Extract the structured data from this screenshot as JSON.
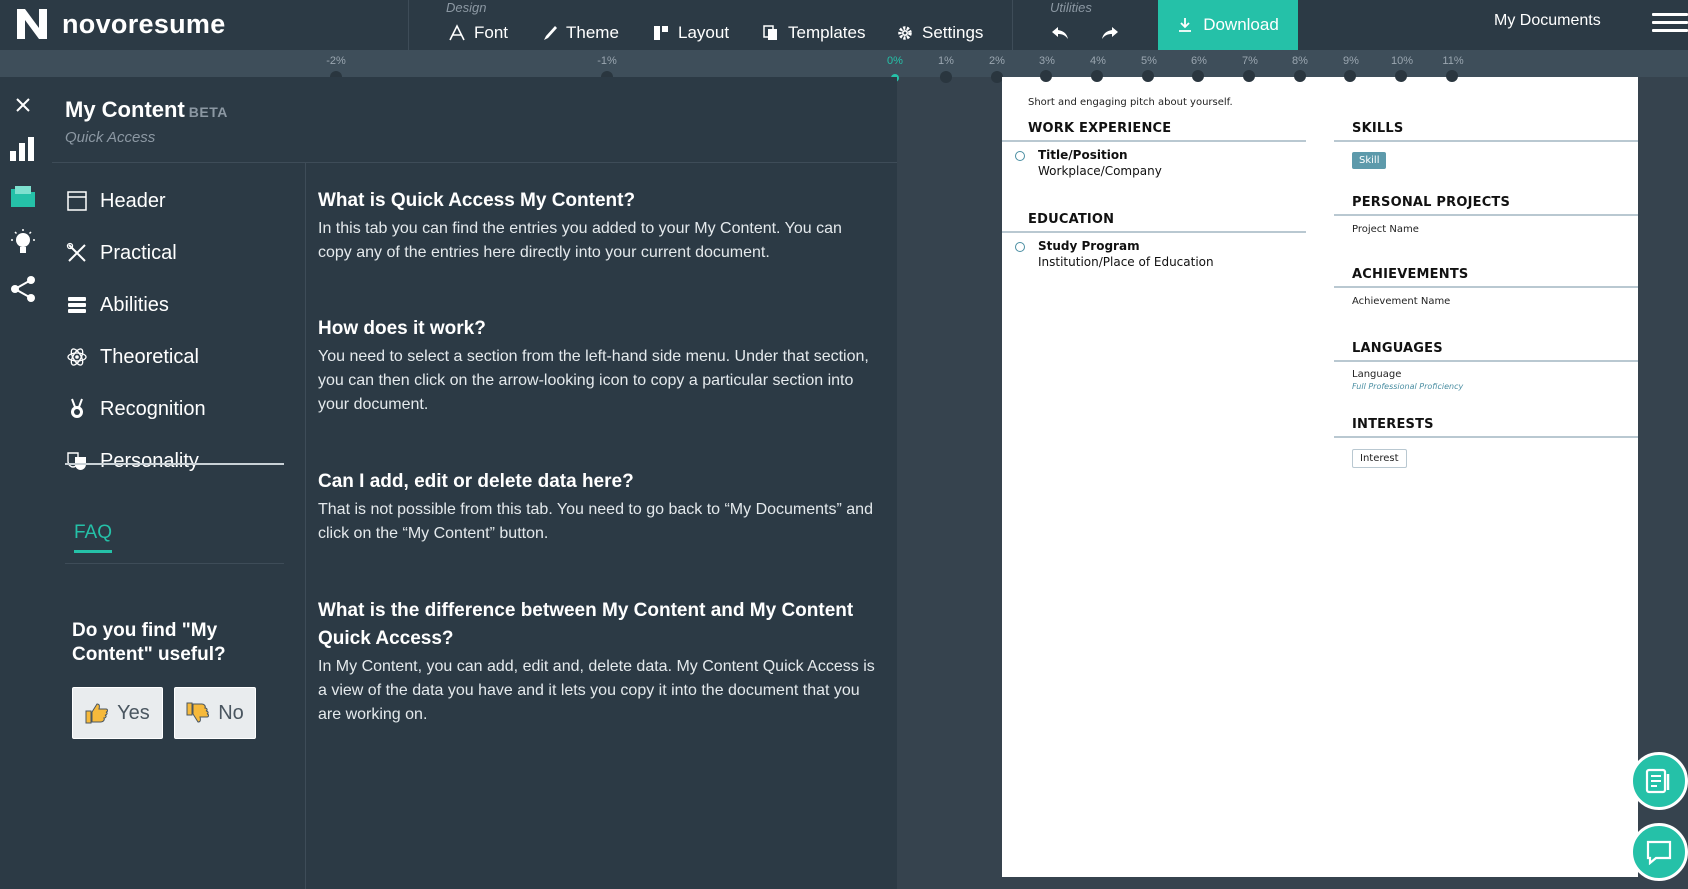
{
  "app": {
    "brand": "novoresume",
    "accent": "#25c1a8"
  },
  "toolbar": {
    "design_label": "Design",
    "font_label": "Font",
    "theme_label": "Theme",
    "layout_label": "Layout",
    "templates_label": "Templates",
    "settings_label": "Settings",
    "utilities_label": "Utilities",
    "download_label": "Download",
    "my_documents_label": "My Documents"
  },
  "ruler": {
    "ticks": [
      "-2%",
      "-1%",
      "0%",
      "1%",
      "2%",
      "3%",
      "4%",
      "5%",
      "6%",
      "7%",
      "8%",
      "9%",
      "10%",
      "11%"
    ],
    "active": "0%"
  },
  "panel": {
    "title": "My Content",
    "badge": "BETA",
    "subtitle": "Quick Access",
    "menu": [
      {
        "label": "Header",
        "icon": "header-icon"
      },
      {
        "label": "Practical",
        "icon": "tools-icon"
      },
      {
        "label": "Abilities",
        "icon": "stack-icon"
      },
      {
        "label": "Theoretical",
        "icon": "atom-icon"
      },
      {
        "label": "Recognition",
        "icon": "medal-icon"
      },
      {
        "label": "Personality",
        "icon": "masks-icon"
      }
    ],
    "faq_link": "FAQ",
    "useful_question": "Do you find \"My Content\" useful?",
    "yes_label": "Yes",
    "no_label": "No"
  },
  "faq": [
    {
      "q": "What is Quick Access My Content?",
      "a": "In this tab you can find the entries you added to your My Content. You can copy any of the entries here directly into your current document."
    },
    {
      "q": "How does it work?",
      "a": "You need to select a section from the left-hand side menu. Under that section, you can then click on the arrow-looking icon to copy a particular section into your document."
    },
    {
      "q": "Can I add, edit or delete data here?",
      "a": "That is not possible from this tab. You need to go back to “My Documents” and click on the “My Content” button."
    },
    {
      "q": "What is the difference between My Content and My Content Quick Access?",
      "a": "In My Content, you can add, edit and, delete data. My Content Quick Access is a view of the data you have and it lets you copy it into the document that you are working on."
    }
  ],
  "resume": {
    "pitch": "Short and engaging pitch about yourself.",
    "work_heading": "WORK EXPERIENCE",
    "work_title": "Title/Position",
    "work_company": "Workplace/Company",
    "education_heading": "EDUCATION",
    "edu_title": "Study Program",
    "edu_institution": "Institution/Place of Education",
    "skills_heading": "SKILLS",
    "skill": "Skill",
    "projects_heading": "PERSONAL PROJECTS",
    "project": "Project Name",
    "achievements_heading": "ACHIEVEMENTS",
    "achievement": "Achievement Name",
    "languages_heading": "LANGUAGES",
    "language": "Language",
    "proficiency": "Full Professional Proficiency",
    "interests_heading": "INTERESTS",
    "interest": "Interest"
  }
}
